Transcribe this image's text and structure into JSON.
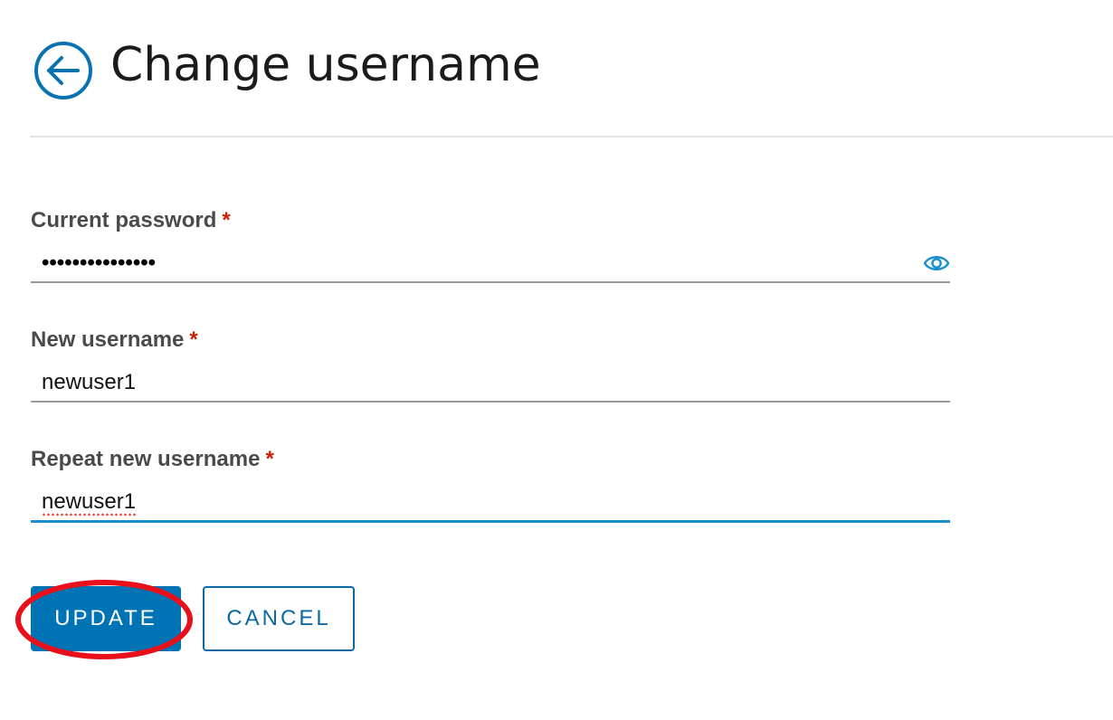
{
  "header": {
    "title": "Change username",
    "back_icon": "arrow-left-circle-icon"
  },
  "form": {
    "current_password": {
      "label": "Current password",
      "required_mark": "*",
      "masked_value": "•••••••••••••••",
      "toggle_icon": "eye-icon"
    },
    "new_username": {
      "label": "New username",
      "required_mark": "*",
      "value": "newuser1"
    },
    "repeat_username": {
      "label": "Repeat new username",
      "required_mark": "*",
      "value": "newuser1",
      "focused": true
    }
  },
  "actions": {
    "update_label": "UPDATE",
    "cancel_label": "CANCEL"
  },
  "colors": {
    "accent": "#0073b4",
    "required": "#c92100",
    "focus_underline": "#1a8fce",
    "annotation_ring": "#e8101a"
  }
}
